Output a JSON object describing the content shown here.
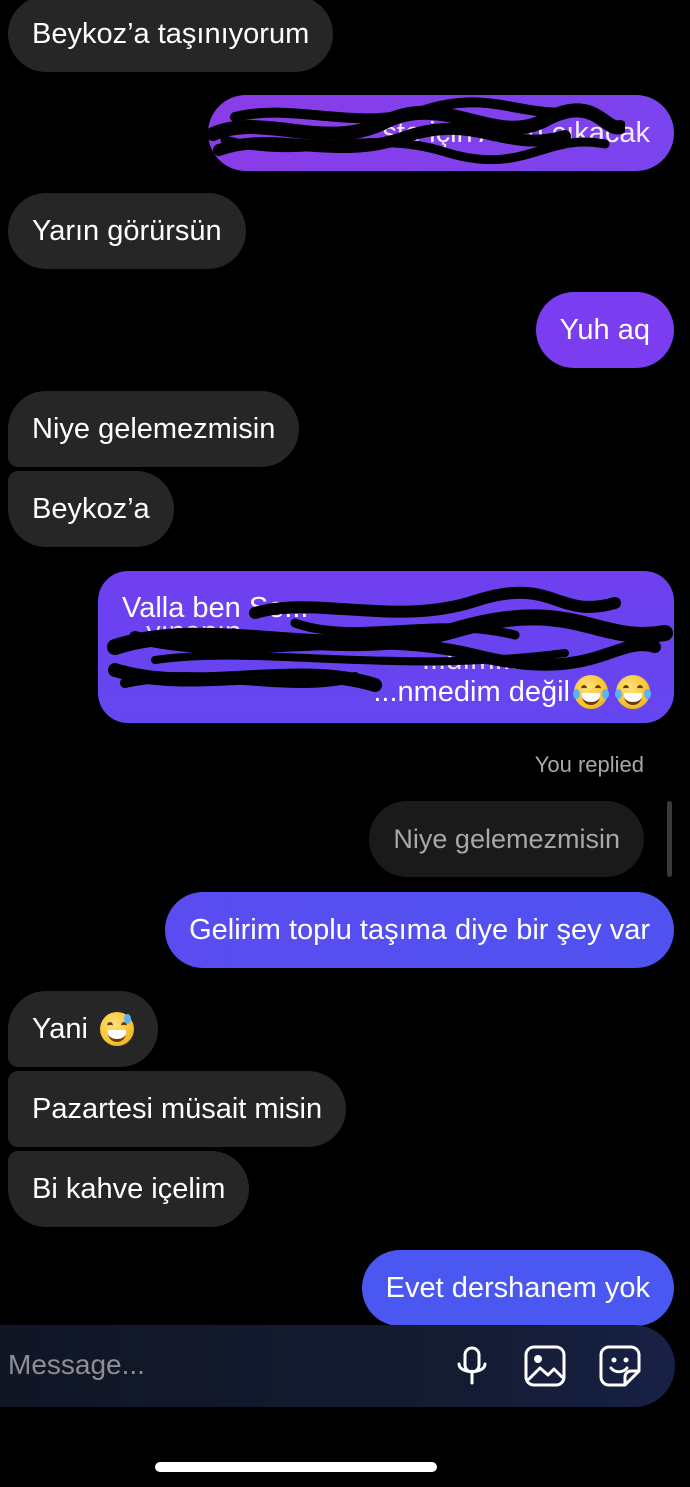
{
  "messages": [
    {
      "id": "m1",
      "direction": "incoming",
      "text": "Beykoz’a taşınıyorum"
    },
    {
      "id": "m2",
      "direction": "outgoing",
      "text": "...ste için Allah çıkacak",
      "redacted": true
    },
    {
      "id": "m3",
      "direction": "incoming",
      "text": "Yarın görürsün"
    },
    {
      "id": "m4",
      "direction": "outgoing",
      "text": "Yuh aq"
    },
    {
      "id": "m5",
      "direction": "incoming",
      "text": "Niye gelemezmisin"
    },
    {
      "id": "m6",
      "direction": "incoming",
      "text": "Beykoz’a"
    },
    {
      "id": "m7",
      "direction": "outgoing",
      "redacted": true,
      "lines": [
        "Valla ben Se...",
        "...yınanın...",
        "...dım...",
        "...nmedim değil"
      ],
      "emoji": [
        "face-with-tears-of-joy",
        "face-with-tears-of-joy"
      ]
    },
    {
      "id": "m8",
      "direction": "outgoing",
      "reply_label": "You replied",
      "quoted_text": "Niye gelemezmisin",
      "text": "Gelirim toplu taşıma diye bir şey var"
    },
    {
      "id": "m9",
      "direction": "incoming",
      "text": "Yani",
      "emoji": "grinning-face-with-sweat"
    },
    {
      "id": "m10",
      "direction": "incoming",
      "text": "Pazartesi müsait misin"
    },
    {
      "id": "m11",
      "direction": "incoming",
      "text": "Bi kahve içelim"
    },
    {
      "id": "m12",
      "direction": "outgoing",
      "text": "Evet dershanem yok"
    }
  ],
  "composer": {
    "placeholder": "Message...",
    "icons": [
      "microphone-icon",
      "gallery-icon",
      "sticker-icon"
    ]
  },
  "colors": {
    "background": "#000000",
    "incoming_bubble": "#262626",
    "outgoing_purple": "#7a3df0",
    "outgoing_blue": "#4a57f0",
    "secondary_text": "#a8a8a8"
  }
}
